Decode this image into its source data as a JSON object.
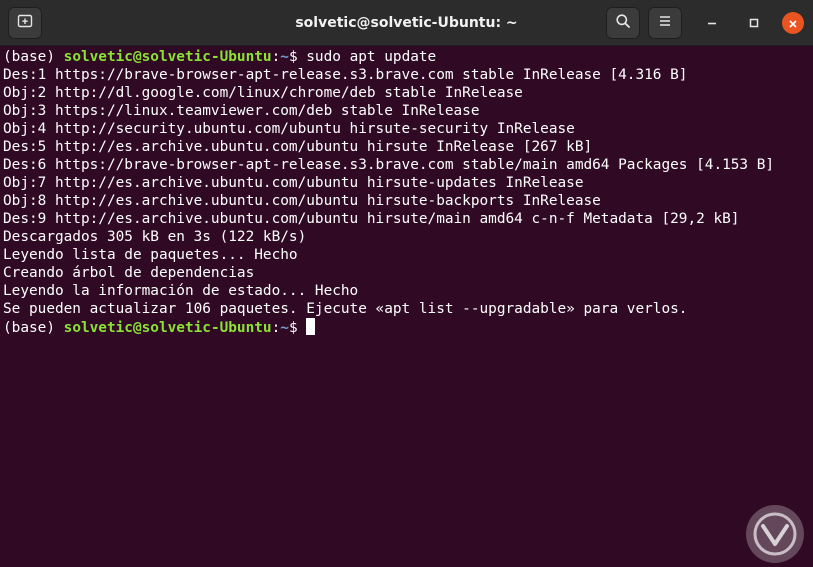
{
  "window": {
    "title": "solvetic@solvetic-Ubuntu: ~"
  },
  "icons": {
    "new_tab": "new-tab-icon",
    "search": "search-icon",
    "menu": "hamburger-menu-icon",
    "minimize": "minimize-icon",
    "maximize": "maximize-icon",
    "close": "close-icon",
    "watermark": "solvetic-logo-icon"
  },
  "colors": {
    "terminal_bg": "#300a24",
    "titlebar_bg": "#2c2c2c",
    "user_host": "#8ae234",
    "path": "#729fcf",
    "close_button": "#e95420"
  },
  "terminal": {
    "prompt": {
      "env": "(base) ",
      "user_host": "solvetic@solvetic-Ubuntu",
      "separator": ":",
      "path": "~",
      "symbol": "$ "
    },
    "command": "sudo apt update",
    "output": [
      "Des:1 https://brave-browser-apt-release.s3.brave.com stable InRelease [4.316 B]",
      "Obj:2 http://dl.google.com/linux/chrome/deb stable InRelease",
      "Obj:3 https://linux.teamviewer.com/deb stable InRelease",
      "Obj:4 http://security.ubuntu.com/ubuntu hirsute-security InRelease",
      "Des:5 http://es.archive.ubuntu.com/ubuntu hirsute InRelease [267 kB]",
      "Des:6 https://brave-browser-apt-release.s3.brave.com stable/main amd64 Packages [4.153 B]",
      "Obj:7 http://es.archive.ubuntu.com/ubuntu hirsute-updates InRelease",
      "Obj:8 http://es.archive.ubuntu.com/ubuntu hirsute-backports InRelease",
      "Des:9 http://es.archive.ubuntu.com/ubuntu hirsute/main amd64 c-n-f Metadata [29,2 kB]",
      "Descargados 305 kB en 3s (122 kB/s)",
      "Leyendo lista de paquetes... Hecho",
      "Creando árbol de dependencias",
      "Leyendo la información de estado... Hecho",
      "Se pueden actualizar 106 paquetes. Ejecute «apt list --upgradable» para verlos."
    ]
  }
}
